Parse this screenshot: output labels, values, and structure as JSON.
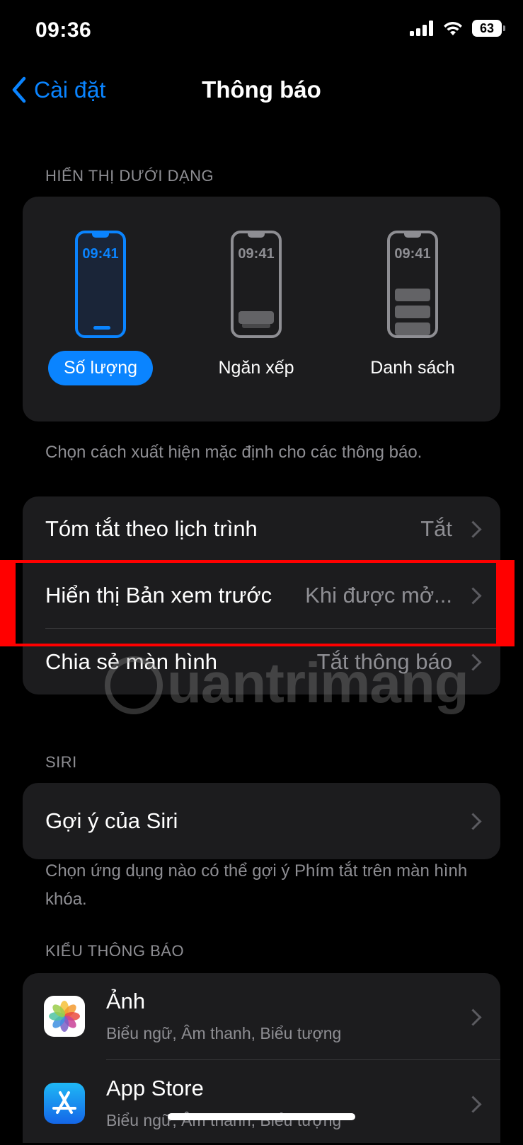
{
  "status_bar": {
    "time": "09:36",
    "battery": "63"
  },
  "nav": {
    "back_label": "Cài đặt",
    "title": "Thông báo"
  },
  "display_section": {
    "header": "HIỂN THỊ DƯỚI DẠNG",
    "options": [
      {
        "label": "Số lượng",
        "preview_time": "09:41",
        "selected": true
      },
      {
        "label": "Ngăn xếp",
        "preview_time": "09:41",
        "selected": false
      },
      {
        "label": "Danh sách",
        "preview_time": "09:41",
        "selected": false
      }
    ],
    "footer": "Chọn cách xuất hiện mặc định cho các thông báo."
  },
  "settings_rows": [
    {
      "label": "Tóm tắt theo lịch trình",
      "value": "Tắt"
    },
    {
      "label": "Hiển thị Bản xem trước",
      "value": "Khi được mở..."
    },
    {
      "label": "Chia sẻ màn hình",
      "value": "Tắt thông báo"
    }
  ],
  "siri_section": {
    "header": "SIRI",
    "row_label": "Gợi ý của Siri",
    "footer": "Chọn ứng dụng nào có thể gợi ý Phím tắt trên màn hình khóa."
  },
  "notification_style": {
    "header": "KIỂU THÔNG BÁO",
    "apps": [
      {
        "name": "Ảnh",
        "subtitle": "Biểu ngữ, Âm thanh, Biểu tượng",
        "icon": "photos-icon"
      },
      {
        "name": "App Store",
        "subtitle": "Biểu ngữ, Âm thanh, Biểu tượng",
        "icon": "app-store-icon"
      }
    ]
  },
  "watermark": "uantrimang",
  "colors": {
    "accent": "#0a84ff",
    "background": "#000000",
    "card": "#1c1c1e",
    "secondary_text": "#8e8e93",
    "highlight": "#ff0000"
  }
}
